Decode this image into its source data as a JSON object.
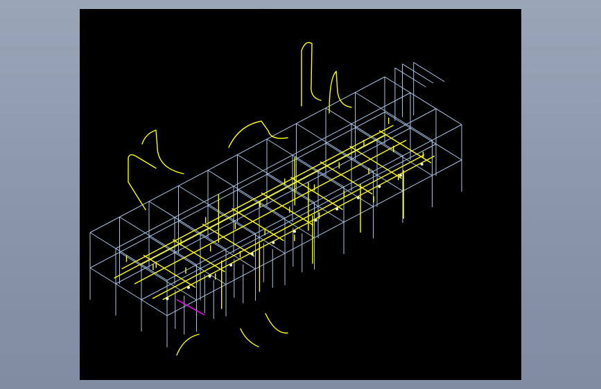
{
  "drawing": {
    "kind": "isometric piping layout (CAD wireframe)",
    "background_color": "#000000",
    "frame_color": "#a9c4e8",
    "pipe_color": "#ffff00",
    "valve_color": "#ffffff",
    "highlight_color": "#ff00ff"
  }
}
